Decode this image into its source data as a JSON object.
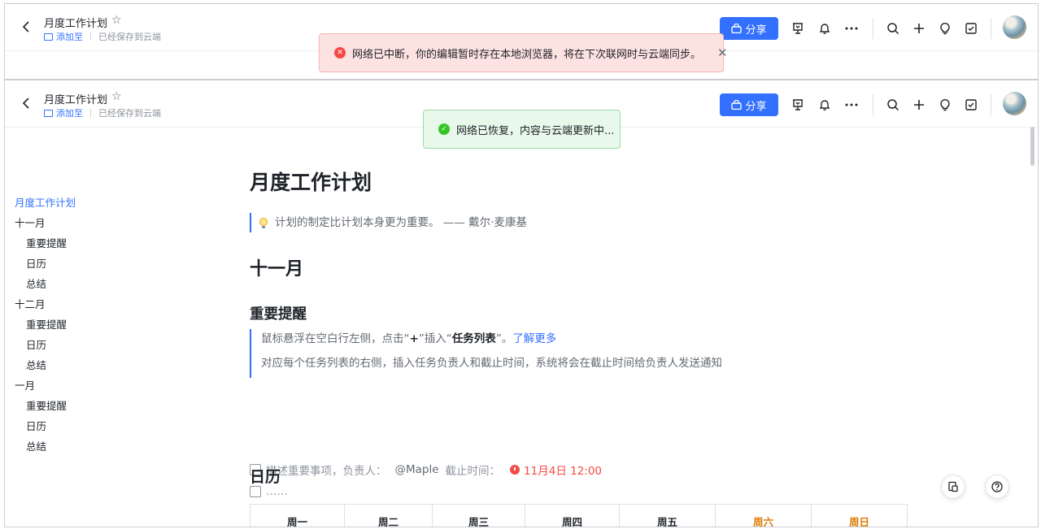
{
  "doc": {
    "title": "月度工作计划",
    "add_to": "添加至",
    "saved_status": "已经保存到云端",
    "share_label": "分享"
  },
  "toasts": {
    "error": "网络已中断，你的编辑暂时存在本地浏览器，将在下次联网时与云端同步。",
    "success": "网络已恢复，内容与云端更新中..."
  },
  "toc": [
    {
      "label": "月度工作计划",
      "level": 1,
      "active": true
    },
    {
      "label": "十一月",
      "level": 1
    },
    {
      "label": "重要提醒",
      "level": 2
    },
    {
      "label": "日历",
      "level": 2
    },
    {
      "label": "总结",
      "level": 2
    },
    {
      "label": "十二月",
      "level": 1
    },
    {
      "label": "重要提醒",
      "level": 2
    },
    {
      "label": "日历",
      "level": 2
    },
    {
      "label": "总结",
      "level": 2
    },
    {
      "label": "一月",
      "level": 1
    },
    {
      "label": "重要提醒",
      "level": 2
    },
    {
      "label": "日历",
      "level": 2
    },
    {
      "label": "总结",
      "level": 2
    }
  ],
  "content": {
    "title": "月度工作计划",
    "quote": "计划的制定比计划本身更为重要。 —— 戴尔·麦康基",
    "month": "十一月",
    "reminder_heading": "重要提醒",
    "tip1_prefix": "鼠标悬浮在空白行左侧，点击“",
    "tip1_plus": "+",
    "tip1_mid": "”插入“",
    "tip1_bold": "任务列表",
    "tip1_suffix": "”。",
    "tip1_link": "了解更多",
    "tip2": "对应每个任务列表的右侧，插入任务负责人和截止时间，系统将会在截止时间给负责人发送通知",
    "task1_text": "描述重要事项，负责人：",
    "task1_assignee": "@Maple",
    "task1_due_label": "截止时间：",
    "task1_due": "11月4日 12:00",
    "task2_text": "……",
    "calendar_heading": "日历",
    "weekdays": [
      "周一",
      "周二",
      "周三",
      "周四",
      "周五",
      "周六",
      "周日"
    ]
  },
  "icons": {
    "back": "chevron-left-icon",
    "star": "star-icon",
    "presentation": "presentation-icon",
    "bell": "bell-icon",
    "more": "more-icon",
    "search": "search-icon",
    "plus": "plus-icon",
    "bulb": "lightbulb-icon",
    "task": "task-checkbox-icon",
    "help": "help-icon"
  },
  "colors": {
    "accent": "#3370ff",
    "error": "#f54a45",
    "success": "#34c724",
    "weekend": "#de7802"
  }
}
